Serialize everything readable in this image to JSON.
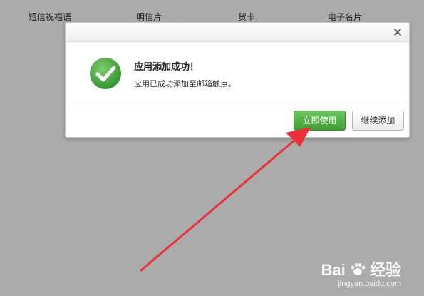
{
  "background_tabs": [
    {
      "label": "短信祝福语"
    },
    {
      "label": "明信片"
    },
    {
      "label": "贺卡"
    },
    {
      "label": "电子名片"
    }
  ],
  "dialog": {
    "close_icon": "close-icon",
    "status_icon": "success-check-icon",
    "title": "应用添加成功！",
    "message": "应用已成功添加至邮箱触点。",
    "primary_button": "立即使用",
    "secondary_button": "继续添加"
  },
  "watermark": {
    "brand_text": "Bai",
    "brand_suffix": "经验",
    "url": "jingyan.baidu.com"
  },
  "colors": {
    "overlay": "#ababab",
    "primary_green": "#4caf3f",
    "success_green": "#43a33a",
    "annotation_red": "#e8313a"
  }
}
